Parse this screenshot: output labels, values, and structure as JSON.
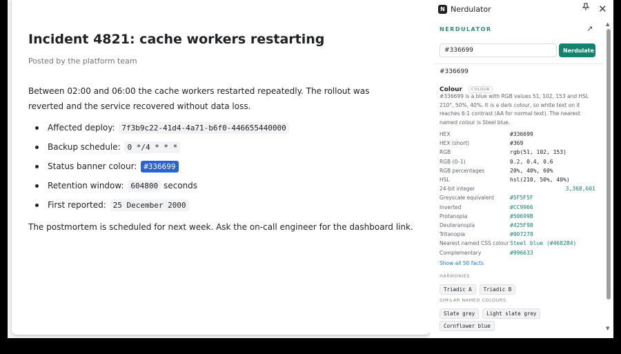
{
  "article": {
    "title": "Incident 4821: cache workers restarting",
    "byline": "Posted by the platform team",
    "intro": "Between 02:00 and 06:00 the cache workers restarted repeatedly. The rollout was reverted and the service recovered without data loss.",
    "facts": [
      {
        "label": "Affected deploy:",
        "value": "7f3b9c22-41d4-4a71-b6f0-446655440000",
        "suffix": ""
      },
      {
        "label": "Backup schedule:",
        "value": "0 */4 * * *",
        "suffix": ""
      },
      {
        "label": "Status banner colour:",
        "value": "#336699",
        "suffix": ""
      },
      {
        "label": "Retention window:",
        "value": "604800",
        "suffix": "seconds"
      },
      {
        "label": "First reported:",
        "value": "25 December 2000",
        "suffix": ""
      }
    ],
    "outro": "The postmortem is scheduled for next week. Ask the on-call engineer for the dashboard link."
  },
  "panel": {
    "extension_icon_letter": "N",
    "title": "Nerdulator",
    "brand": "NERDULATOR",
    "pin_icon": "pin-icon",
    "close_icon": "close-icon",
    "open_icon": "open-in-new-icon",
    "search": {
      "value": "#336699",
      "button_label": "Nerdulate"
    },
    "result": {
      "value": "#336699",
      "kind": "Colour",
      "kind_badge": "COLOUR",
      "summary": "#336699 is a blue with RGB values 51, 102, 153 and HSL 210°, 50%, 40%. It is a dark colour, so white text on it reaches 6:1 contrast (AA for normal text). The nearest named colour is Steel blue."
    },
    "facts": [
      {
        "key": "HEX",
        "value": "#336699",
        "style": "plain"
      },
      {
        "key": "HEX (short)",
        "value": "#369",
        "style": "plain"
      },
      {
        "key": "RGB",
        "value": "rgb(51, 102, 153)",
        "style": "plain"
      },
      {
        "key": "RGB (0–1)",
        "value": "0.2, 0.4, 0.6",
        "style": "plain"
      },
      {
        "key": "RGB percentages",
        "value": "20%, 40%, 60%",
        "style": "plain"
      },
      {
        "key": "HSL",
        "value": "hsl(210, 50%, 40%)",
        "style": "plain"
      },
      {
        "key": "24-bit integer",
        "value": "3,368,601",
        "style": "num"
      },
      {
        "key": "Greyscale equivalent",
        "value": "#5F5F5F",
        "style": "link"
      },
      {
        "key": "Inverted",
        "value": "#CC9966",
        "style": "link"
      },
      {
        "key": "Protanopia",
        "value": "#50699B",
        "style": "link"
      },
      {
        "key": "Deuteranopia",
        "value": "#425F98",
        "style": "link"
      },
      {
        "key": "Tritanopia",
        "value": "#007278",
        "style": "link"
      },
      {
        "key": "Nearest named CSS colour",
        "value": "Steel blue (#4682B4)",
        "style": "link"
      },
      {
        "key": "Complementary",
        "value": "#996633",
        "style": "link"
      }
    ],
    "show_all": "Show all 50 facts",
    "harmonies_label": "HARMONIES",
    "harmonies": [
      "Triadic A",
      "Triadic B"
    ],
    "similar_label": "SIMILAR NAMED COLOURS",
    "similar_row1": [
      "Slate grey",
      "Light slate grey"
    ],
    "similar_row2": [
      "Cornflower blue"
    ]
  },
  "colors": {
    "accent": "#12836f",
    "brand": "#2b8a7e",
    "selection": "#2a64d0"
  }
}
